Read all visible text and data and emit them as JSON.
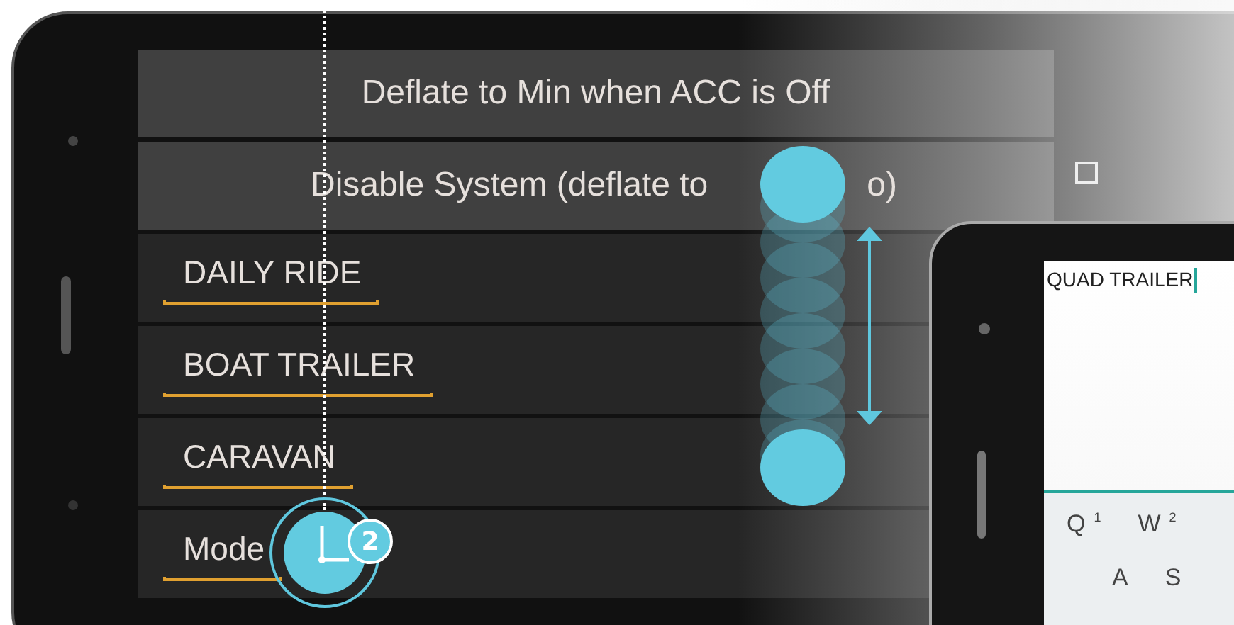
{
  "rows": [
    {
      "kind": "button",
      "label": "Deflate to Min when ACC is Off"
    },
    {
      "kind": "button",
      "label": "Disable System (deflate to",
      "label_end": "o)"
    },
    {
      "kind": "profile",
      "label": "DAILY RIDE"
    },
    {
      "kind": "profile",
      "label": "BOAT TRAILER"
    },
    {
      "kind": "profile",
      "label": "CARAVAN"
    },
    {
      "kind": "profile",
      "label": "Mode"
    }
  ],
  "gesture": {
    "badge": "2"
  },
  "second_phone": {
    "field_value": "QUAD TRAILER",
    "keyboard": [
      [
        {
          "key": "Q",
          "hint": "1"
        },
        {
          "key": "W",
          "hint": "2"
        }
      ],
      [
        {
          "key": "A"
        },
        {
          "key": "S"
        }
      ]
    ]
  }
}
